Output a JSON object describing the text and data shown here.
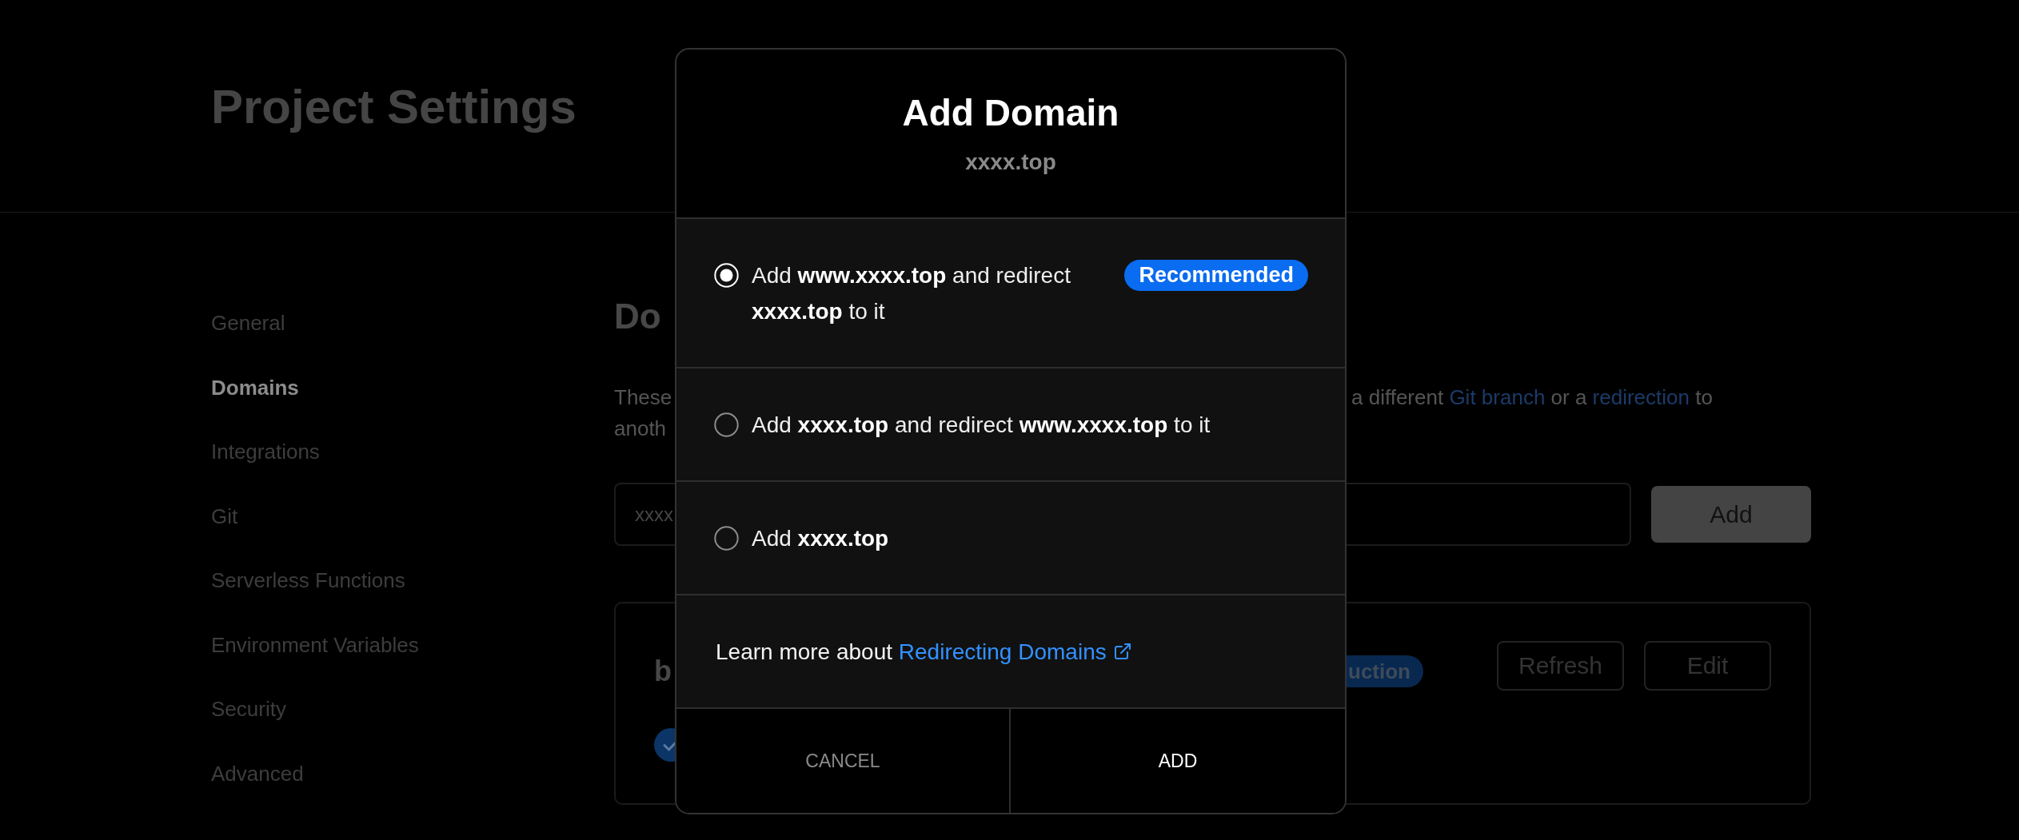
{
  "page": {
    "title": "Project Settings"
  },
  "sidebar": {
    "items": [
      {
        "label": "General",
        "selected": false
      },
      {
        "label": "Domains",
        "selected": true
      },
      {
        "label": "Integrations",
        "selected": false
      },
      {
        "label": "Git",
        "selected": false
      },
      {
        "label": "Serverless Functions",
        "selected": false
      },
      {
        "label": "Environment Variables",
        "selected": false
      },
      {
        "label": "Security",
        "selected": false
      },
      {
        "label": "Advanced",
        "selected": false
      }
    ]
  },
  "main": {
    "heading": "Do",
    "description": {
      "left_lines": [
        "These",
        "anoth"
      ],
      "right_segments": [
        {
          "kind": "text",
          "text": "a different "
        },
        {
          "kind": "link",
          "text": "Git branch"
        },
        {
          "kind": "text",
          "text": " or a "
        },
        {
          "kind": "link",
          "text": "redirection"
        },
        {
          "kind": "text",
          "text": " to"
        }
      ]
    },
    "domain_input": {
      "value": "xxxx"
    },
    "add_button": "Add",
    "domain_card": {
      "name": "b",
      "badge": "uction",
      "buttons": [
        "Refresh",
        "Edit"
      ]
    }
  },
  "dialog": {
    "title": "Add Domain",
    "subtitle": "xxxx.top",
    "options": [
      {
        "text": "Add **www.xxxx.top** and redirect **xxxx.top** to it",
        "selected": true,
        "badge": "Recommended"
      },
      {
        "text": "Add **xxxx.top** and redirect **www.xxxx.top** to it",
        "selected": false
      },
      {
        "text": "Add **xxxx.top**",
        "selected": false
      }
    ],
    "learn_more": {
      "text": "Learn more about ",
      "link": "Redirecting Domains"
    },
    "buttons": [
      {
        "kind": "cancel",
        "label": "CANCEL"
      },
      {
        "kind": "confirm",
        "label": "ADD"
      }
    ]
  }
}
